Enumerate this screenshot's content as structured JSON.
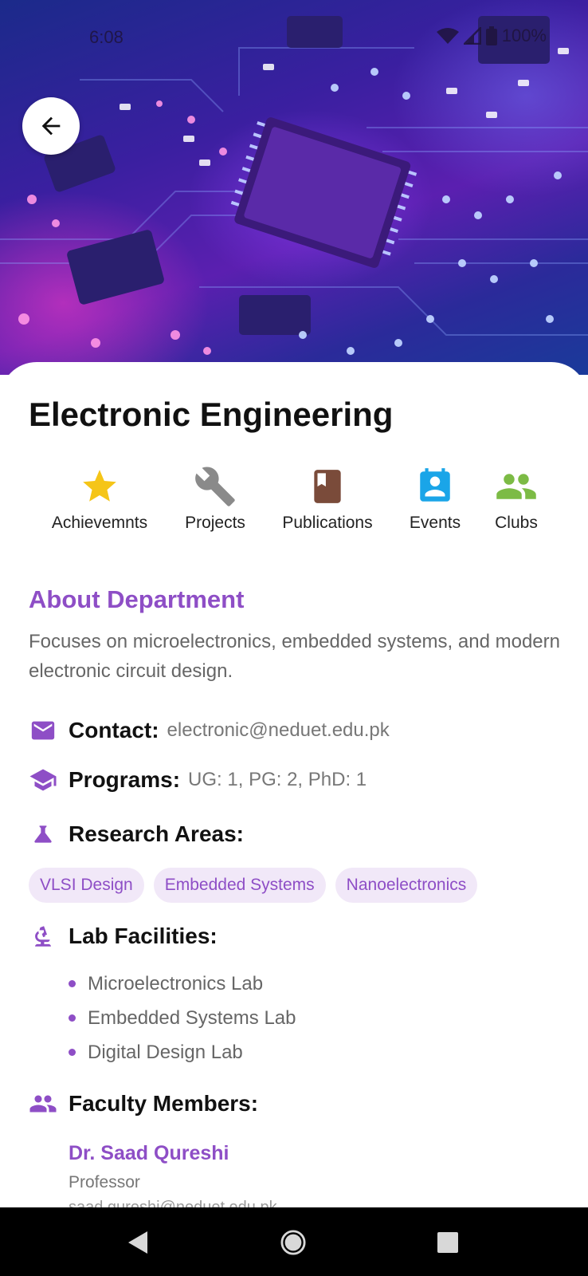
{
  "status": {
    "time": "6:08",
    "battery": "100%"
  },
  "header": {
    "title": "Electronic Engineering"
  },
  "actions": [
    {
      "label": "Achievemnts",
      "icon": "star-icon",
      "color": "#f5c518"
    },
    {
      "label": "Projects",
      "icon": "wrench-icon",
      "color": "#8a8a8a"
    },
    {
      "label": "Publications",
      "icon": "book-icon",
      "color": "#7a4b3a"
    },
    {
      "label": "Events",
      "icon": "calendar-person-icon",
      "color": "#1aa5e8"
    },
    {
      "label": "Clubs",
      "icon": "group-icon",
      "color": "#7cbb45"
    }
  ],
  "about": {
    "title": "About Department",
    "description": "Focuses on microelectronics, embedded systems, and modern electronic circuit design."
  },
  "contact": {
    "label": "Contact:",
    "value": "electronic@neduet.edu.pk"
  },
  "programs": {
    "label": "Programs:",
    "value": "UG: 1, PG: 2, PhD: 1"
  },
  "research": {
    "label": "Research Areas:",
    "areas": [
      "VLSI Design",
      "Embedded Systems",
      "Nanoelectronics"
    ]
  },
  "labs": {
    "label": "Lab Facilities:",
    "items": [
      "Microelectronics Lab",
      "Embedded Systems Lab",
      "Digital Design Lab"
    ]
  },
  "faculty": {
    "label": "Faculty Members:",
    "members": [
      {
        "name": "Dr. Saad Qureshi",
        "role": "Professor",
        "email": "saad.qureshi@neduet.edu.pk"
      }
    ]
  },
  "theme": {
    "accent": "#8e4ec6",
    "chip_bg": "#f1e8f8"
  }
}
